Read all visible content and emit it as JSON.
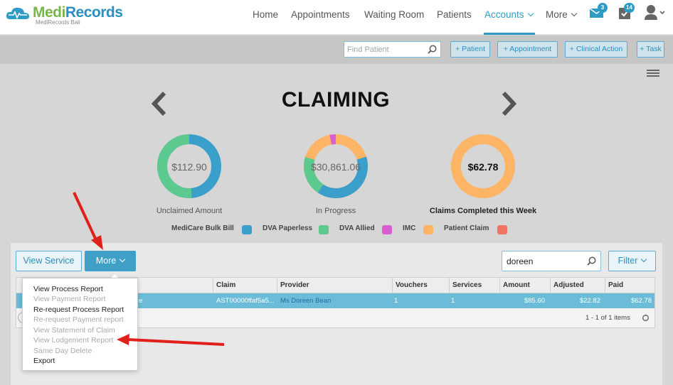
{
  "app": {
    "logo_main_a": "Medi",
    "logo_main_b": "Records",
    "logo_sub": "MediRecords Bali"
  },
  "nav": {
    "items": [
      {
        "label": "Home"
      },
      {
        "label": "Appointments"
      },
      {
        "label": "Waiting Room"
      },
      {
        "label": "Patients"
      },
      {
        "label": "Accounts"
      },
      {
        "label": "More"
      }
    ],
    "active": "Accounts",
    "mail_badge": "3",
    "tasks_badge": "14"
  },
  "toolbar": {
    "find_placeholder": "Find Patient",
    "buttons": [
      {
        "label": "+ Patient"
      },
      {
        "label": "+ Appointment"
      },
      {
        "label": "+ Clinical Action"
      },
      {
        "label": "+ Task"
      }
    ]
  },
  "claiming": {
    "title": "CLAIMING",
    "donuts": [
      {
        "value": "$112.90",
        "label": "Unclaimed Amount"
      },
      {
        "value": "$30,861.06",
        "label": "In Progress"
      },
      {
        "value": "$62.78",
        "label": "Claims Completed this Week"
      }
    ],
    "legend": [
      {
        "label": "MediCare Bulk Bill",
        "color": "#3a9fcb"
      },
      {
        "label": "DVA Paperless",
        "color": "#5cc98e"
      },
      {
        "label": "DVA Allied",
        "color": "#d95fd0"
      },
      {
        "label": "IMC",
        "color": "#fdb565"
      },
      {
        "label": "Patient Claim",
        "color": "#f07462"
      }
    ]
  },
  "actions": {
    "view_service": "View Service",
    "more": "More",
    "search_value": "doreen",
    "filter": "Filter"
  },
  "grid": {
    "columns": [
      "Claim",
      "Provider",
      "Vouchers",
      "Services",
      "Amount",
      "Adjusted",
      "Paid"
    ],
    "row": {
      "hidden_tail": "e",
      "claim": "AST00000ffaf5a5...",
      "provider": "Ms Doreen Bean",
      "vouchers": "1",
      "services": "1",
      "amount": "$85.60",
      "adjusted": "$22.82",
      "paid": "$62.78"
    },
    "pager": "1 - 1 of 1 items"
  },
  "dropdown": {
    "items": [
      {
        "label": "View Process Report",
        "enabled": true
      },
      {
        "label": "View Payment Report",
        "enabled": false
      },
      {
        "label": "Re-request Process Report",
        "enabled": true
      },
      {
        "label": "Re-request Payment report",
        "enabled": false
      },
      {
        "label": "View Statement of Claim",
        "enabled": false
      },
      {
        "label": "View Lodgement Report",
        "enabled": false
      },
      {
        "label": "Same Day Delete",
        "enabled": false
      },
      {
        "label": "Export",
        "enabled": true
      }
    ]
  },
  "colors": {
    "accent": "#2e9bc6",
    "annotation_red": "#e0201a"
  }
}
